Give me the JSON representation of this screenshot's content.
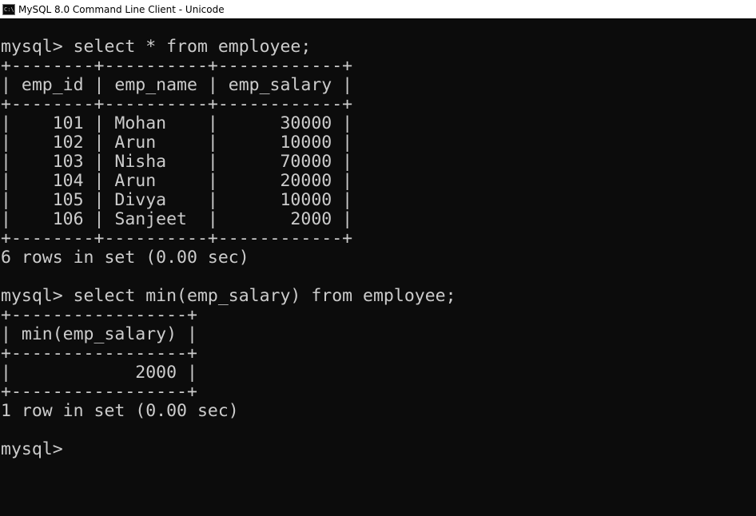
{
  "window": {
    "title": "MySQL 8.0 Command Line Client - Unicode",
    "icon": "console-app-icon"
  },
  "console": {
    "lines": [
      "mysql> select * from employee;",
      "+--------+----------+------------+",
      "| emp_id | emp_name | emp_salary |",
      "+--------+----------+------------+",
      "|    101 | Mohan    |      30000 |",
      "|    102 | Arun     |      10000 |",
      "|    103 | Nisha    |      70000 |",
      "|    104 | Arun     |      20000 |",
      "|    105 | Divya    |      10000 |",
      "|    106 | Sanjeet  |       2000 |",
      "+--------+----------+------------+",
      "6 rows in set (0.00 sec)",
      "",
      "mysql> select min(emp_salary) from employee;",
      "+-----------------+",
      "| min(emp_salary) |",
      "+-----------------+",
      "|            2000 |",
      "+-----------------+",
      "1 row in set (0.00 sec)",
      "",
      "mysql>"
    ]
  },
  "colors": {
    "background": "#0c0c0c",
    "text": "#cccccc",
    "titlebar": "#ffffff"
  }
}
